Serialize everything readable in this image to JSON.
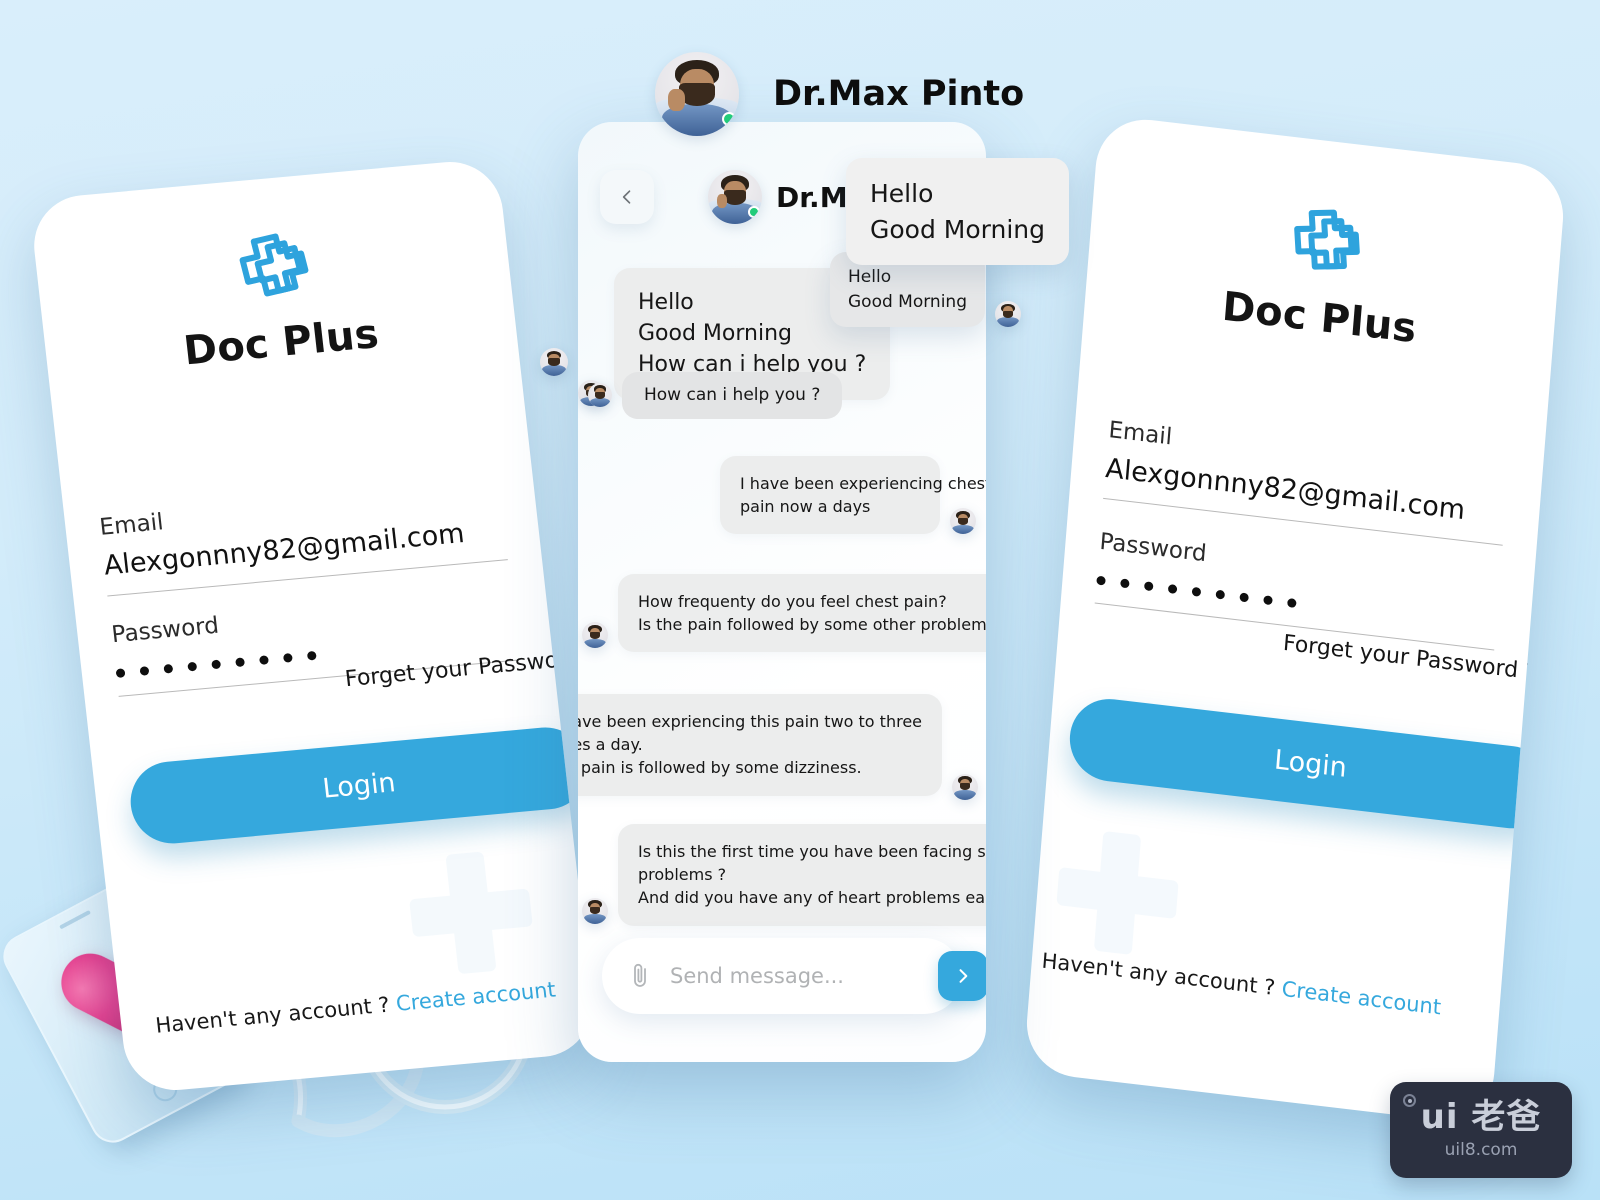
{
  "theme": {
    "background_top": "#d9eefb",
    "background_bottom": "#b9e1f7",
    "accent_blue": "#35a8dd",
    "bubble_gray": "#eceded",
    "text_dark": "#111111",
    "online_green": "#22cc7a"
  },
  "login": {
    "brand": "Doc Plus",
    "email_label": "Email",
    "email_value": "Alexgonnny82@gmail.com",
    "email_placeholder": "Email",
    "password_label": "Password",
    "password_value": "• • • • • • • • •",
    "password_dot_count": 9,
    "forgot_label": "Forget your Password ?",
    "login_button": "Login",
    "signup_prompt": "Haven't any account ?",
    "signup_link": "Create account"
  },
  "chat": {
    "floating_title": "Dr.Max Pinto",
    "header_title": "Dr.Max Pinto",
    "back_icon": "chevron-left-icon",
    "avatar_name": "doctor-avatar",
    "status": "online",
    "overlay_bubbles": [
      {
        "id": "overlay-hello-large",
        "lines": [
          "Hello",
          "Good Morning"
        ]
      },
      {
        "id": "overlay-hello-small",
        "lines": [
          "Hello",
          "Good Morning"
        ]
      },
      {
        "id": "overlay-help-small",
        "lines": [
          "How can i help you ?"
        ]
      }
    ],
    "messages": [
      {
        "id": "msg-greeting",
        "sender": "doctor",
        "side": "left",
        "lines": [
          "Hello",
          "Good Morning",
          "How can i help you ?"
        ]
      },
      {
        "id": "msg-chest-pain",
        "sender": "patient",
        "side": "right",
        "lines": [
          "I have been experiencing  chest",
          "pain  now a days"
        ]
      },
      {
        "id": "msg-frequency",
        "sender": "doctor",
        "side": "left",
        "lines": [
          "How frequenty do you feel chest pain?",
          "Is the pain followed by some other problems ?"
        ]
      },
      {
        "id": "msg-two-to-three",
        "sender": "patient",
        "side": "right",
        "lines": [
          "It have been expriencing this pain two to three",
          "times a day.",
          "The pain is followed by some dizziness."
        ]
      },
      {
        "id": "msg-first-time",
        "sender": "doctor",
        "side": "left",
        "lines": [
          "Is this the first time you have been facing such",
          "problems ?",
          "And did you have any of heart problems earlier?"
        ]
      }
    ],
    "composer": {
      "attach_icon": "paperclip-icon",
      "placeholder": "Send message...",
      "value": "",
      "send_icon": "chevron-right-icon"
    }
  },
  "props": {
    "phone_mockup": "smartphone-prop",
    "heart": "heart-prop",
    "stethoscope": "stethoscope-prop",
    "dna": "dna-helix-prop"
  },
  "watermark": {
    "main": "ui 老爸",
    "sub": "uil8.com"
  }
}
